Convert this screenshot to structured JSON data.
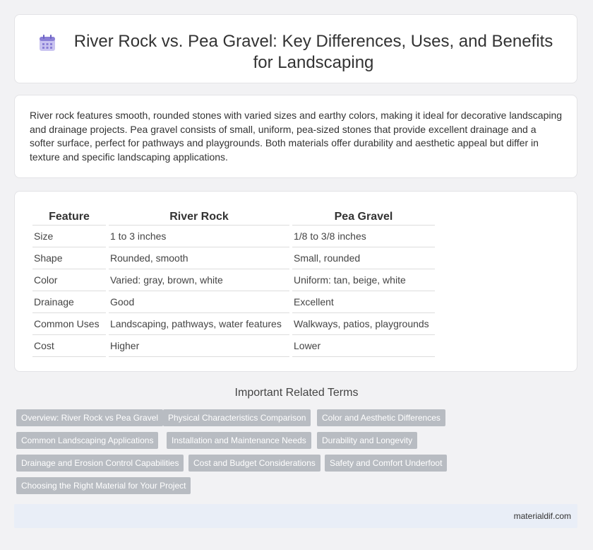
{
  "header": {
    "title": "River Rock vs. Pea Gravel: Key Differences, Uses, and Benefits for Landscaping",
    "icon": "calendar-icon"
  },
  "intro": {
    "text": "River rock features smooth, rounded stones with varied sizes and earthy colors, making it ideal for decorative landscaping and drainage projects. Pea gravel consists of small, uniform, pea-sized stones that provide excellent drainage and a softer surface, perfect for pathways and playgrounds. Both materials offer durability and aesthetic appeal but differ in texture and specific landscaping applications."
  },
  "table": {
    "headers": [
      "Feature",
      "River Rock",
      "Pea Gravel"
    ],
    "rows": [
      [
        "Size",
        "1 to 3 inches",
        "1/8 to 3/8 inches"
      ],
      [
        "Shape",
        "Rounded, smooth",
        "Small, rounded"
      ],
      [
        "Color",
        "Varied: gray, brown, white",
        "Uniform: tan, beige, white"
      ],
      [
        "Drainage",
        "Good",
        "Excellent"
      ],
      [
        "Common Uses",
        "Landscaping, pathways, water features",
        "Walkways, patios, playgrounds"
      ],
      [
        "Cost",
        "Higher",
        "Lower"
      ]
    ]
  },
  "terms": {
    "title": "Important Related Terms",
    "items": [
      "Overview: River Rock vs Pea Gravel",
      "Physical Characteristics Comparison",
      "Color and Aesthetic Differences",
      "Common Landscaping Applications",
      "Installation and Maintenance Needs",
      "Durability and Longevity",
      "Drainage and Erosion Control Capabilities",
      "Cost and Budget Considerations",
      "Safety and Comfort Underfoot",
      "Choosing the Right Material for Your Project"
    ]
  },
  "footer": {
    "site": "materialdif.com"
  },
  "colors": {
    "tag_bg": "#b8bcc2",
    "footer_bg": "#e9eef7",
    "icon_accent": "#8a7fd6"
  }
}
